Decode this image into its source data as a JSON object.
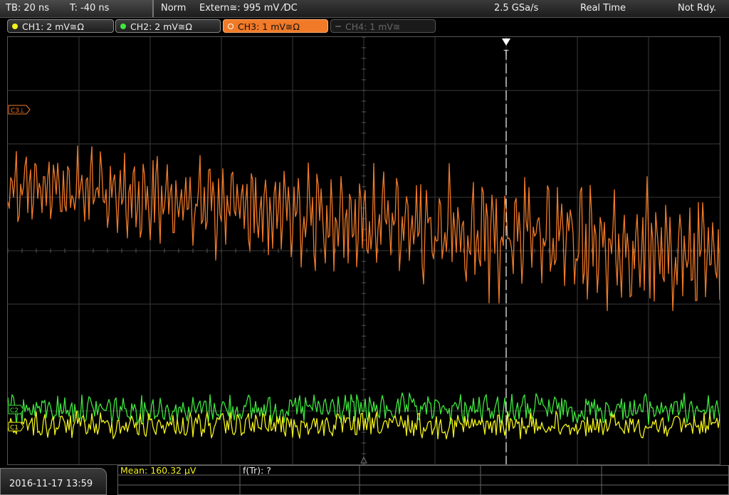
{
  "topbar": {
    "timebase": "TB: 20 ns",
    "trigger_offset": "T: -40 ns",
    "trigger_mode": "Norm",
    "trigger_source": "Extern≅: 995 mV ⁄DC",
    "sample_rate": "2.5 GSa/s",
    "acq_mode": "Real Time",
    "status": "Not Rdy."
  },
  "channels": [
    {
      "label": "CH1: 2 mV≅Ω",
      "color": "#f2f21a",
      "active": true
    },
    {
      "label": "CH2: 2 mV≅Ω",
      "color": "#3ee63e",
      "active": true
    },
    {
      "label": "CH3: 1 mV≅Ω",
      "color": "#f07a28",
      "active": true,
      "selected": true
    },
    {
      "label": "CH4: 1 mV≅",
      "color": "#666666",
      "active": false
    }
  ],
  "markers": {
    "ch3_ref": "C3⊥",
    "ch1_ref": "C1",
    "ch2_ref": "C2",
    "trigger": "T"
  },
  "bottombar": {
    "datetime": "2016-11-17 13:59",
    "mean_label": "Mean: 160.32 μV",
    "freq_label": "f(Tr): ?"
  },
  "colors": {
    "grid": "#3a3a3a",
    "ch1": "#f2f21a",
    "ch2": "#3ee63e",
    "ch3": "#f07a28",
    "trigger_line": "#ffffff"
  }
}
